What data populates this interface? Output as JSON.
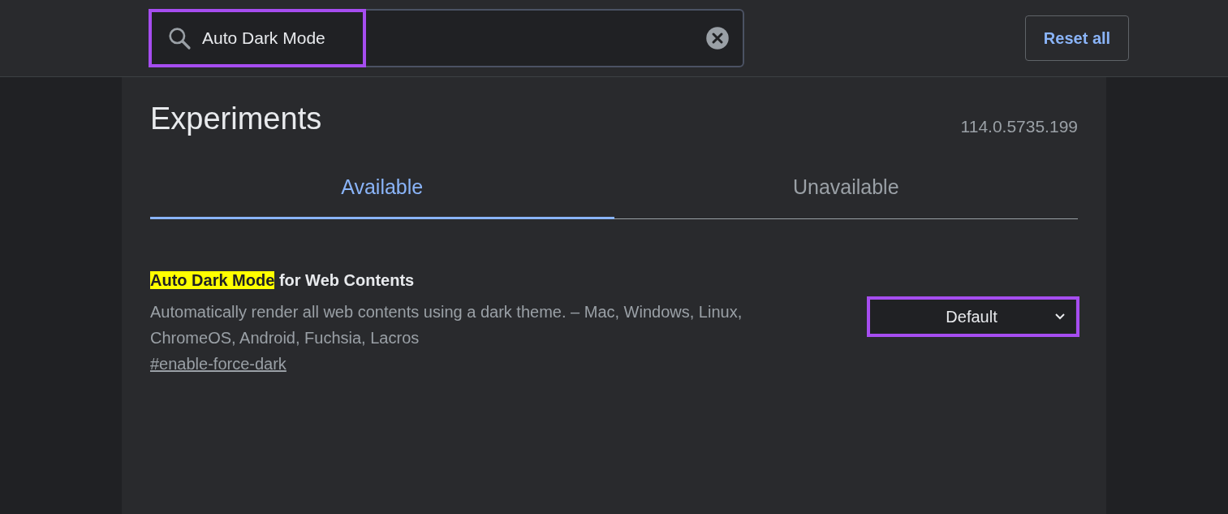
{
  "search": {
    "value": "Auto Dark Mode",
    "highlighted": true
  },
  "reset_button": "Reset all",
  "title": "Experiments",
  "version": "114.0.5735.199",
  "tabs": [
    {
      "label": "Available",
      "selected": true
    },
    {
      "label": "Unavailable",
      "selected": false
    }
  ],
  "experiments": [
    {
      "match": "Auto Dark Mode",
      "title_rest": "for Web Contents",
      "description": "Automatically render all web contents using a dark theme. – Mac, Windows, Linux, ChromeOS, Android, Fuchsia, Lacros",
      "link": "#enable-force-dark",
      "value": "Default",
      "highlighted": true
    }
  ]
}
